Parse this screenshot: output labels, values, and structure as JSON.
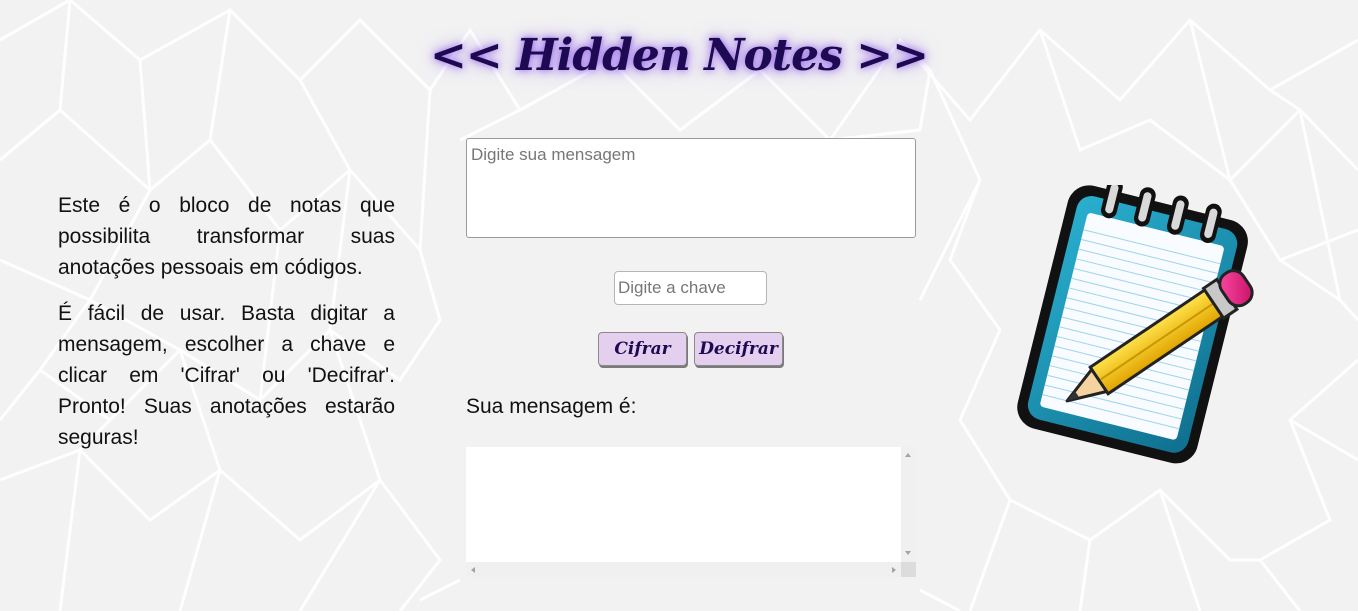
{
  "app": {
    "title": "<< Hidden Notes >>"
  },
  "intro": {
    "paragraph_1": "Este é o bloco de notas que possibilita transformar suas anotações pessoais em códigos.",
    "paragraph_2": "É fácil de usar. Basta digitar a mensagem, escolher a chave e clicar em 'Cifrar' ou 'Decifrar'. Pronto! Suas anotações estarão seguras!"
  },
  "form": {
    "message_placeholder": "Digite sua mensagem",
    "message_value": "",
    "key_placeholder": "Digite a chave",
    "key_value": "",
    "cipher_label": "Cifrar",
    "decipher_label": "Decifrar"
  },
  "result": {
    "label": "Sua mensagem é:",
    "value": ""
  },
  "icons": {
    "illustration": "notepad-pencil-icon"
  },
  "colors": {
    "title": "#1e0a52",
    "button_bg": "#e4cfee",
    "notepad_cover": "#1a8fb0",
    "pencil_body": "#f5c400",
    "eraser": "#e8127a"
  }
}
